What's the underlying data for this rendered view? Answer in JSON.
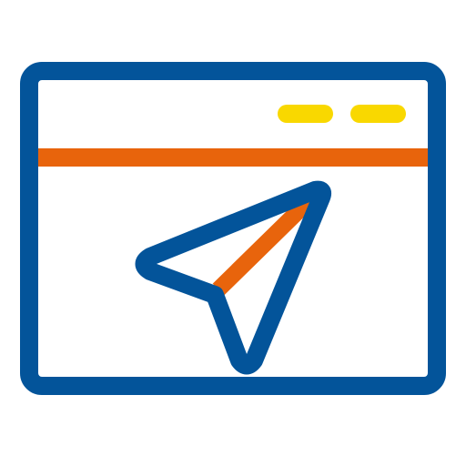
{
  "icon": {
    "name": "browser-window-navigation-icon",
    "parts": [
      "browser-window-frame-icon",
      "window-control-dot-icon",
      "title-bar-divider",
      "navigation-arrow-icon"
    ]
  },
  "colors": {
    "frame": "#03549A",
    "divider": "#E8640C",
    "controls": "#F9D800",
    "arrow_outline": "#03549A",
    "arrow_spine": "#E8640C",
    "background": "#FFFFFF"
  }
}
